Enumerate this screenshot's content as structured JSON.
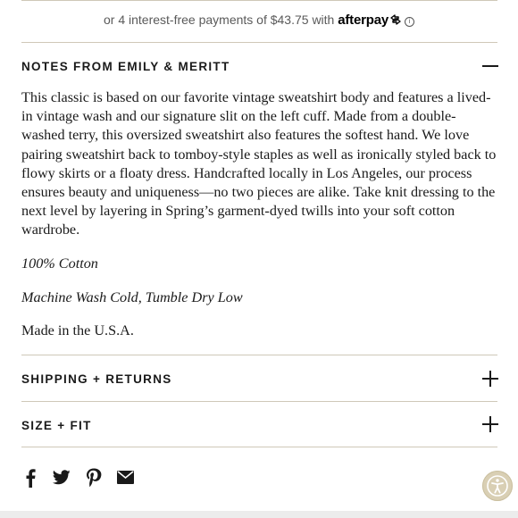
{
  "payments": {
    "prefix": "or 4 interest-free payments of $43.75 with",
    "brand": "afterpay",
    "icon": "afterpay-arrows-icon",
    "info_icon": "info-icon",
    "info_glyph": "i"
  },
  "notes": {
    "title": "NOTES FROM EMILY & MERITT",
    "state_icon": "minus-icon",
    "description": "This classic is based on our favorite vintage sweatshirt body and features a lived-in vintage wash and our signature slit on the left cuff. Made from a double-washed terry, this oversized sweatshirt also features the softest hand. We love pairing sweatshirt back to tomboy-style staples as well as ironically styled back to flowy skirts or a floaty dress. Handcrafted locally in Los Angeles, our process ensures beauty and uniqueness—no two pieces are alike. Take knit dressing to the next level by layering in Spring’s garment-dyed twills into your soft cotton wardrobe.",
    "material": "100% Cotton",
    "care": "Machine Wash Cold, Tumble Dry Low",
    "origin": "Made in the U.S.A."
  },
  "shipping": {
    "title": "SHIPPING + RETURNS",
    "state_icon": "plus-icon"
  },
  "size": {
    "title": "SIZE + FIT",
    "state_icon": "plus-icon"
  },
  "share": {
    "icons": [
      "facebook-icon",
      "twitter-icon",
      "pinterest-icon",
      "email-icon"
    ]
  },
  "accessibility_button": {
    "icon": "accessibility-icon"
  },
  "colors": {
    "divider": "#cfc8b8",
    "text": "#1a1a1a",
    "accessibility_bg": "#d9cfb4"
  }
}
